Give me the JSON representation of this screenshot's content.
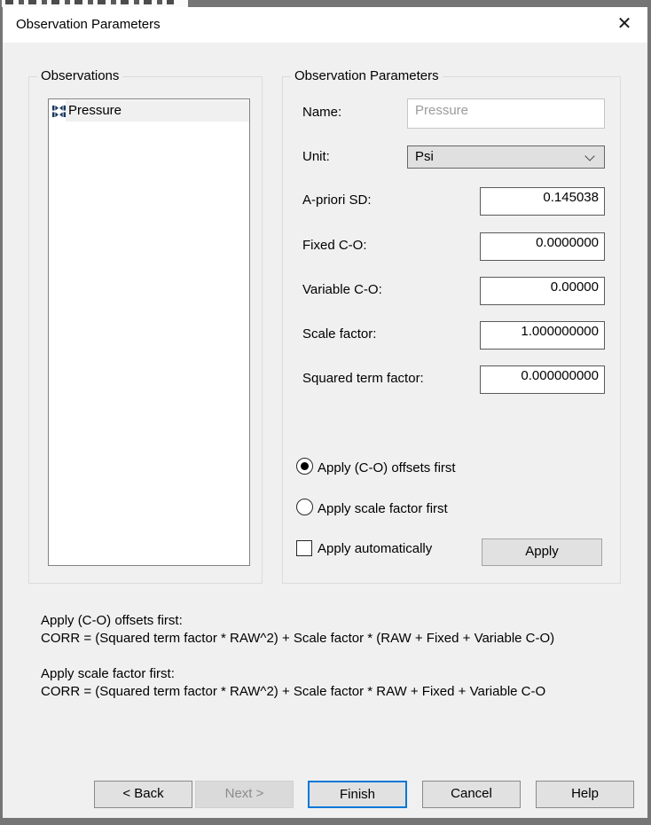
{
  "window": {
    "title": "Observation Parameters",
    "close_glyph": "✕"
  },
  "observations_group": {
    "label": "Observations",
    "items": [
      {
        "label": "Pressure",
        "icon": "compress-arrows-icon",
        "selected": true
      }
    ]
  },
  "params_group": {
    "label": "Observation Parameters",
    "fields": {
      "name": {
        "label": "Name:",
        "value": "Pressure",
        "disabled": true
      },
      "unit": {
        "label": "Unit:",
        "value": "Psi"
      },
      "apriori_sd": {
        "label": "A-priori SD:",
        "value": "0.145038"
      },
      "fixed_co": {
        "label": "Fixed C-O:",
        "value": "0.0000000"
      },
      "variable_co": {
        "label": "Variable C-O:",
        "value": "0.00000"
      },
      "scale_factor": {
        "label": "Scale factor:",
        "value": "1.000000000"
      },
      "squared_term": {
        "label": "Squared term factor:",
        "value": "0.000000000"
      }
    },
    "radios": [
      {
        "label": "Apply (C-O) offsets first",
        "selected": true
      },
      {
        "label": "Apply scale factor first",
        "selected": false
      }
    ],
    "checkbox": {
      "label": "Apply automatically",
      "checked": false
    },
    "apply_button": "Apply"
  },
  "formulas": {
    "first_title": "Apply (C-O) offsets first:",
    "first_formula": "CORR = (Squared term factor * RAW^2) + Scale factor * (RAW + Fixed + Variable C-O)",
    "second_title": "Apply scale factor first:",
    "second_formula": "CORR = (Squared term factor * RAW^2) + Scale factor * RAW + Fixed + Variable C-O"
  },
  "footer": {
    "back": "< Back",
    "next": "Next >",
    "finish": "Finish",
    "cancel": "Cancel",
    "help": "Help"
  },
  "colors": {
    "accent_blue": "#0078d7",
    "dialog_bg": "#f0f0f0",
    "titlebar_bg": "#ffffff",
    "frame_gray": "#757575",
    "icon_navy": "#17375e"
  }
}
